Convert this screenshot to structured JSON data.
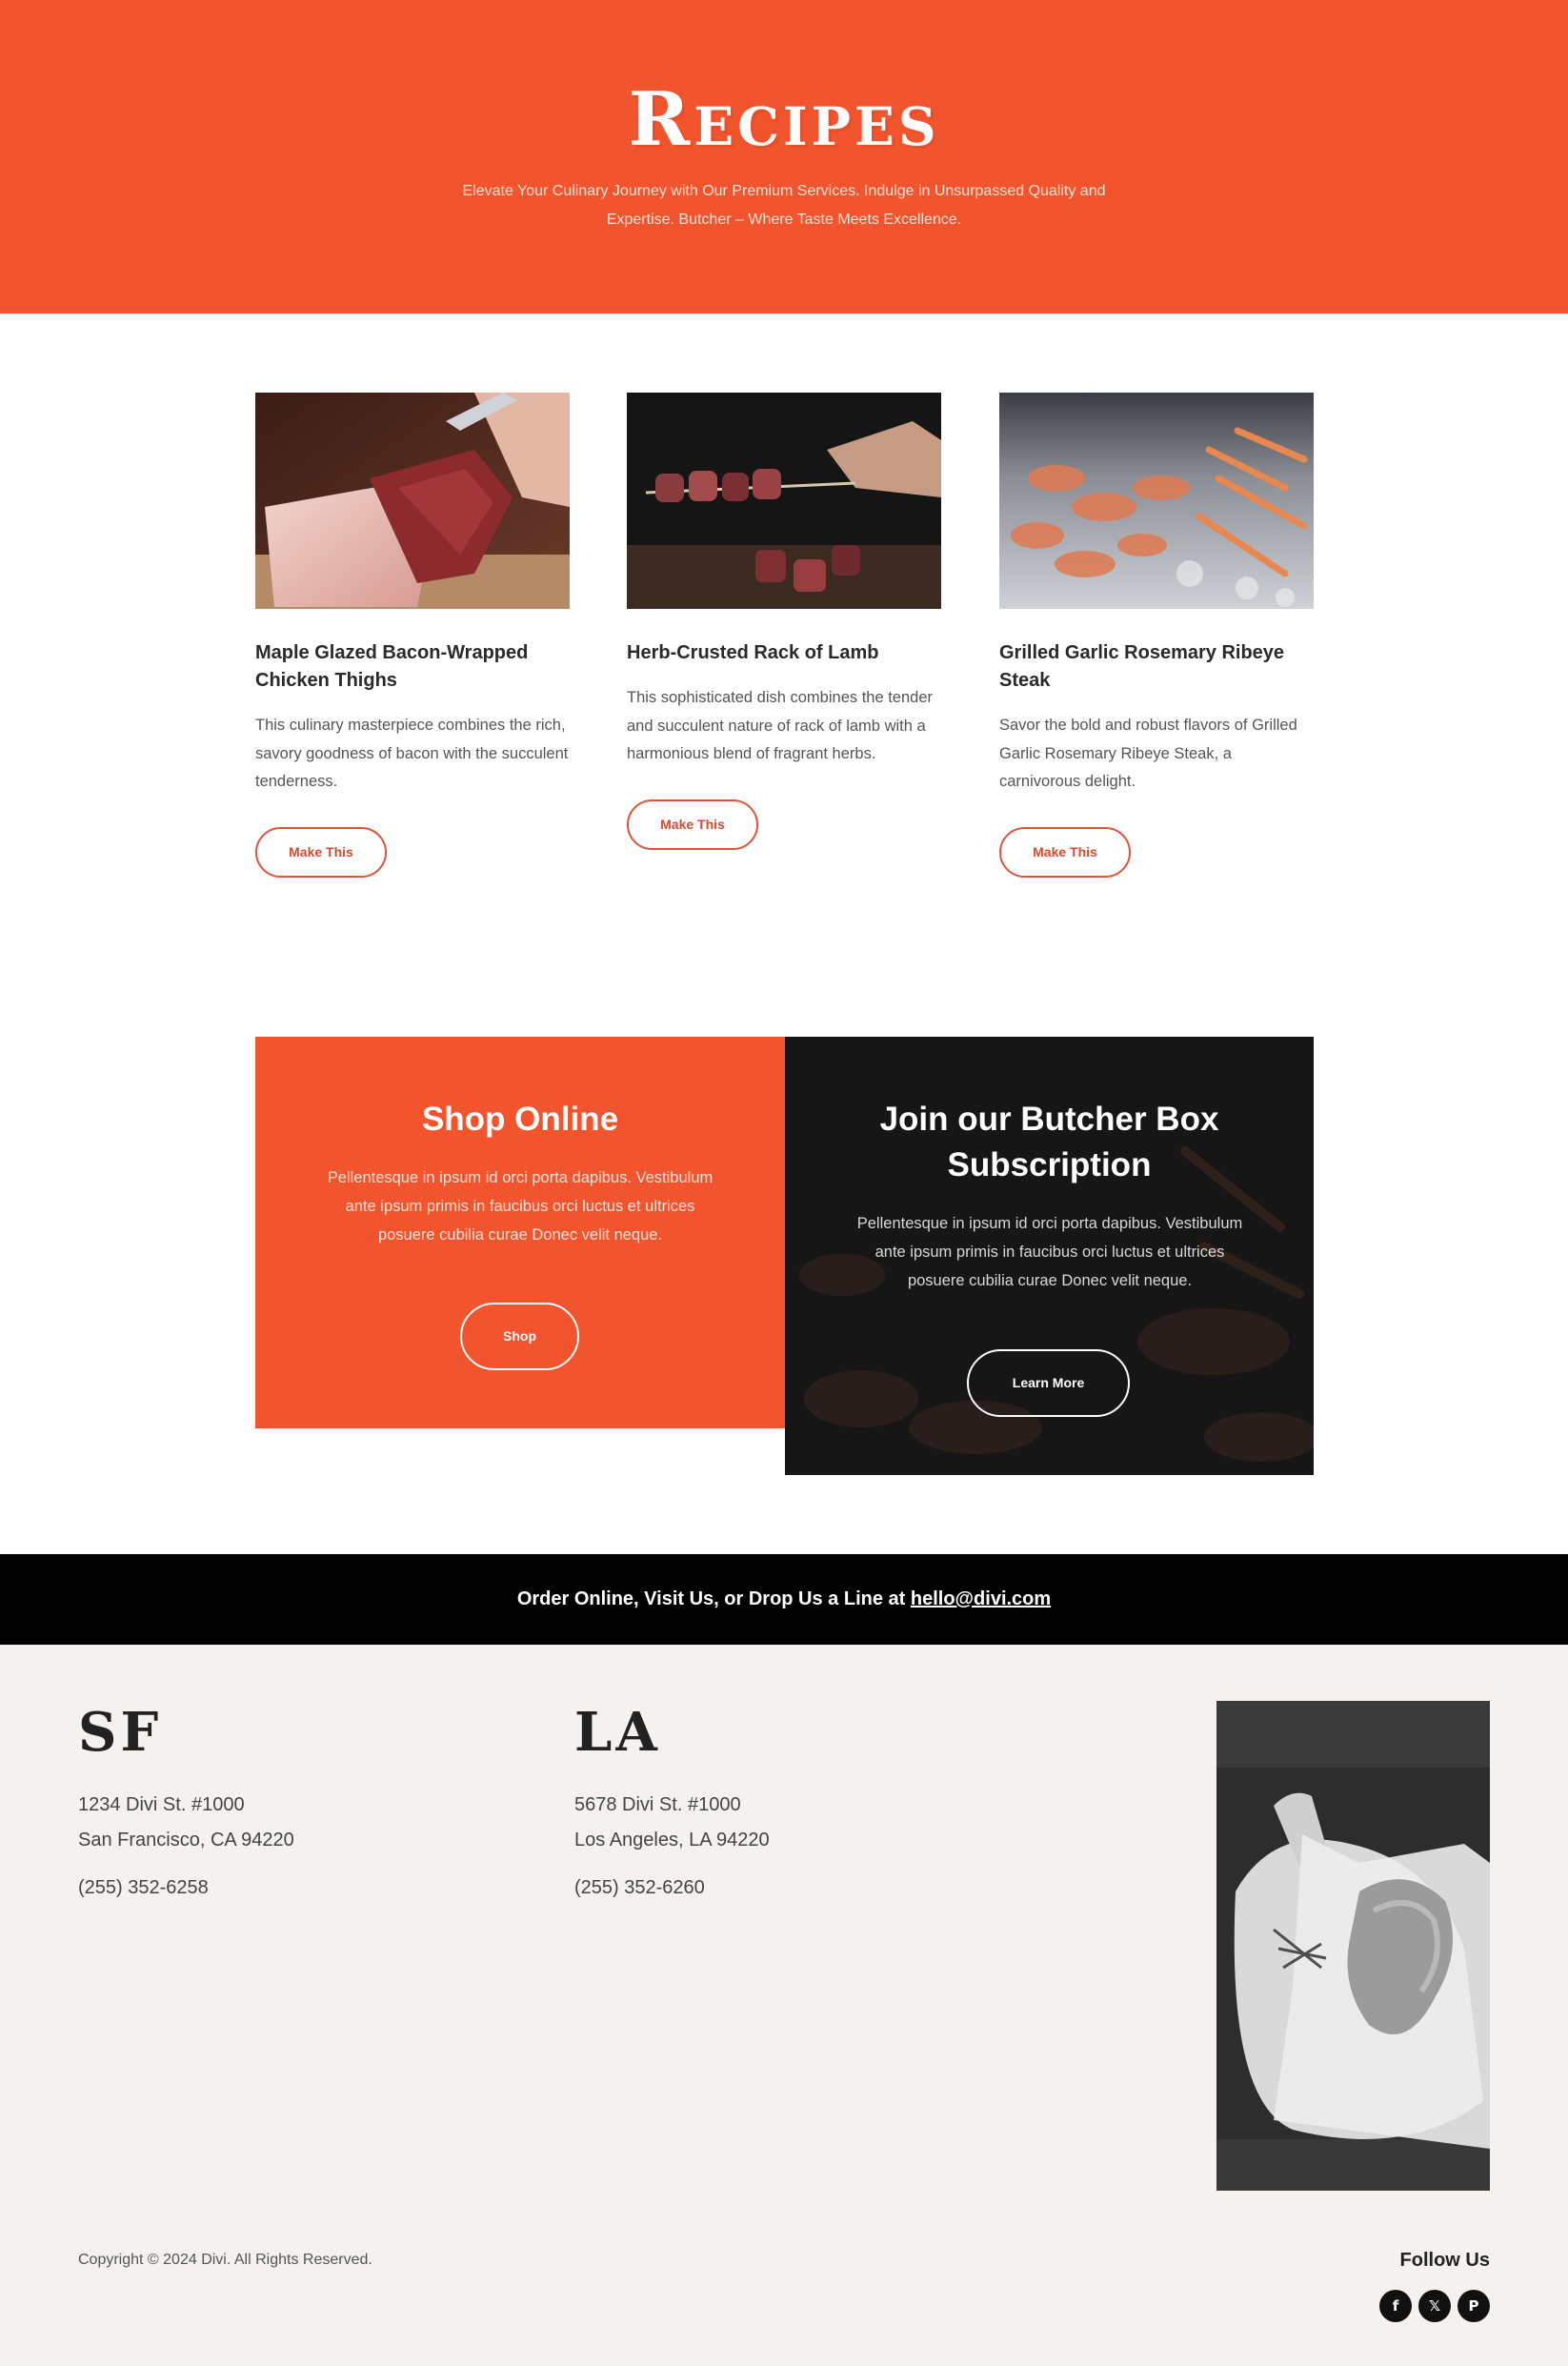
{
  "hero": {
    "title": "Recipes",
    "subtitle": "Elevate Your Culinary Journey with Our Premium Services. Indulge in Unsurpassed Quality and Expertise. Butcher – Where Taste Meets Excellence.",
    "background": "#f2542d"
  },
  "recipes": [
    {
      "title": "Maple Glazed Bacon-Wrapped Chicken Thighs",
      "description": "This culinary masterpiece combines the rich, savory goodness of bacon with the succulent tenderness.",
      "button": "Make This",
      "image": "raw-beef-cutting-photo"
    },
    {
      "title": "Herb-Crusted Rack of Lamb",
      "description": "This sophisticated dish combines the tender and succulent nature of rack of lamb with a harmonious blend of fragrant herbs.",
      "button": "Make This",
      "image": "meat-skewers-photo"
    },
    {
      "title": "Grilled Garlic Rosemary Ribeye Steak",
      "description": "Savor the bold and robust flavors of Grilled Garlic Rosemary Ribeye Steak, a carnivorous delight.",
      "button": "Make This",
      "image": "seafood-on-ice-photo"
    }
  ],
  "cta": {
    "shop": {
      "title": "Shop Online",
      "text": "Pellentesque in ipsum id orci porta dapibus. Vestibulum ante ipsum primis in faucibus orci luctus et ultrices posuere cubilia curae Donec velit neque.",
      "button": "Shop"
    },
    "subscription": {
      "title": "Join our Butcher Box Subscription",
      "text": "Pellentesque in ipsum id orci porta dapibus. Vestibulum ante ipsum primis in faucibus orci luctus et ultrices posuere cubilia curae Donec velit neque.",
      "button": "Learn More"
    }
  },
  "banner": {
    "text": "Order Online, Visit Us, or Drop Us a Line at ",
    "email": "hello@divi.com"
  },
  "footer": {
    "locations": [
      {
        "city": "SF",
        "address_line1": "1234 Divi St. #1000",
        "address_line2": "San Francisco, CA 94220",
        "phone": "(255) 352-6258"
      },
      {
        "city": "LA",
        "address_line1": "5678 Divi St. #1000",
        "address_line2": "Los Angeles, LA 94220",
        "phone": "(255) 352-6260"
      }
    ],
    "image": "steak-on-cutting-board-photo",
    "copyright": "Copyright © 2024 Divi. All Rights Reserved.",
    "follow_label": "Follow Us",
    "social": [
      {
        "icon": "facebook-icon",
        "glyph": "f"
      },
      {
        "icon": "x-icon",
        "glyph": "𝕏"
      },
      {
        "icon": "pinterest-icon",
        "glyph": "P"
      }
    ]
  },
  "colors": {
    "accent": "#f2542d",
    "dark": "#000000",
    "footer_bg": "#f4f1ee"
  }
}
